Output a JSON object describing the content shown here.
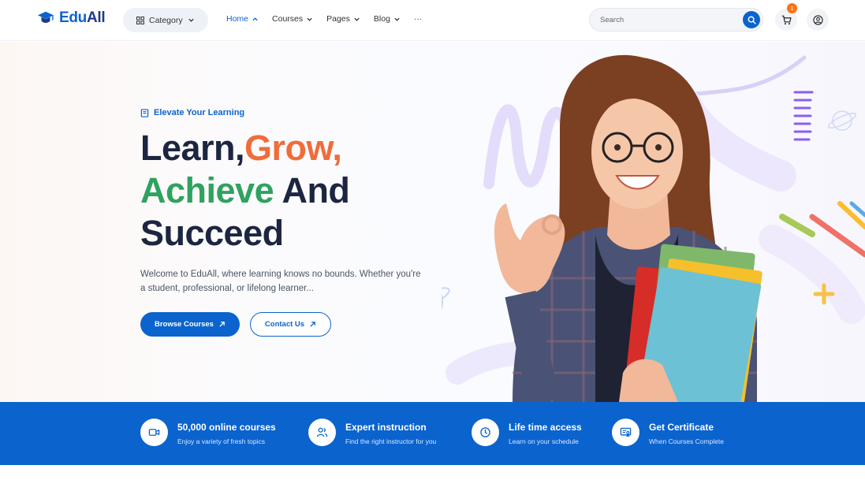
{
  "header": {
    "logo": {
      "part1": "Edu",
      "part2": "All"
    },
    "category_label": "Category",
    "nav": [
      {
        "label": "Home",
        "active": true
      },
      {
        "label": "Courses",
        "active": false
      },
      {
        "label": "Pages",
        "active": false
      },
      {
        "label": "Blog",
        "active": false
      }
    ],
    "more_label": "···",
    "search_placeholder": "Search",
    "cart_count": "1"
  },
  "hero": {
    "tagline": "Elevate Your Learning",
    "headline": {
      "w1": "Learn,",
      "w2": "Grow,",
      "w3": "Achieve",
      "w4": " And",
      "w5": "Succeed"
    },
    "description": "Welcome to EduAll, where learning knows no bounds. Whether you're a student, professional, or lifelong learner...",
    "browse_button": "Browse Courses",
    "contact_button": "Contact Us"
  },
  "features": [
    {
      "icon": "video-icon",
      "title": "50,000 online courses",
      "subtitle": "Enjoy a variety of fresh topics"
    },
    {
      "icon": "users-icon",
      "title": "Expert instruction",
      "subtitle": "Find the right instructor for you"
    },
    {
      "icon": "clock-icon",
      "title": "Life time access",
      "subtitle": "Learn on your schedule"
    },
    {
      "icon": "certificate-icon",
      "title": "Get Certificate",
      "subtitle": "When Courses Complete"
    }
  ],
  "colors": {
    "brand": "#0b63ce",
    "accent_orange": "#f06c3a",
    "accent_green": "#2fa25f"
  }
}
